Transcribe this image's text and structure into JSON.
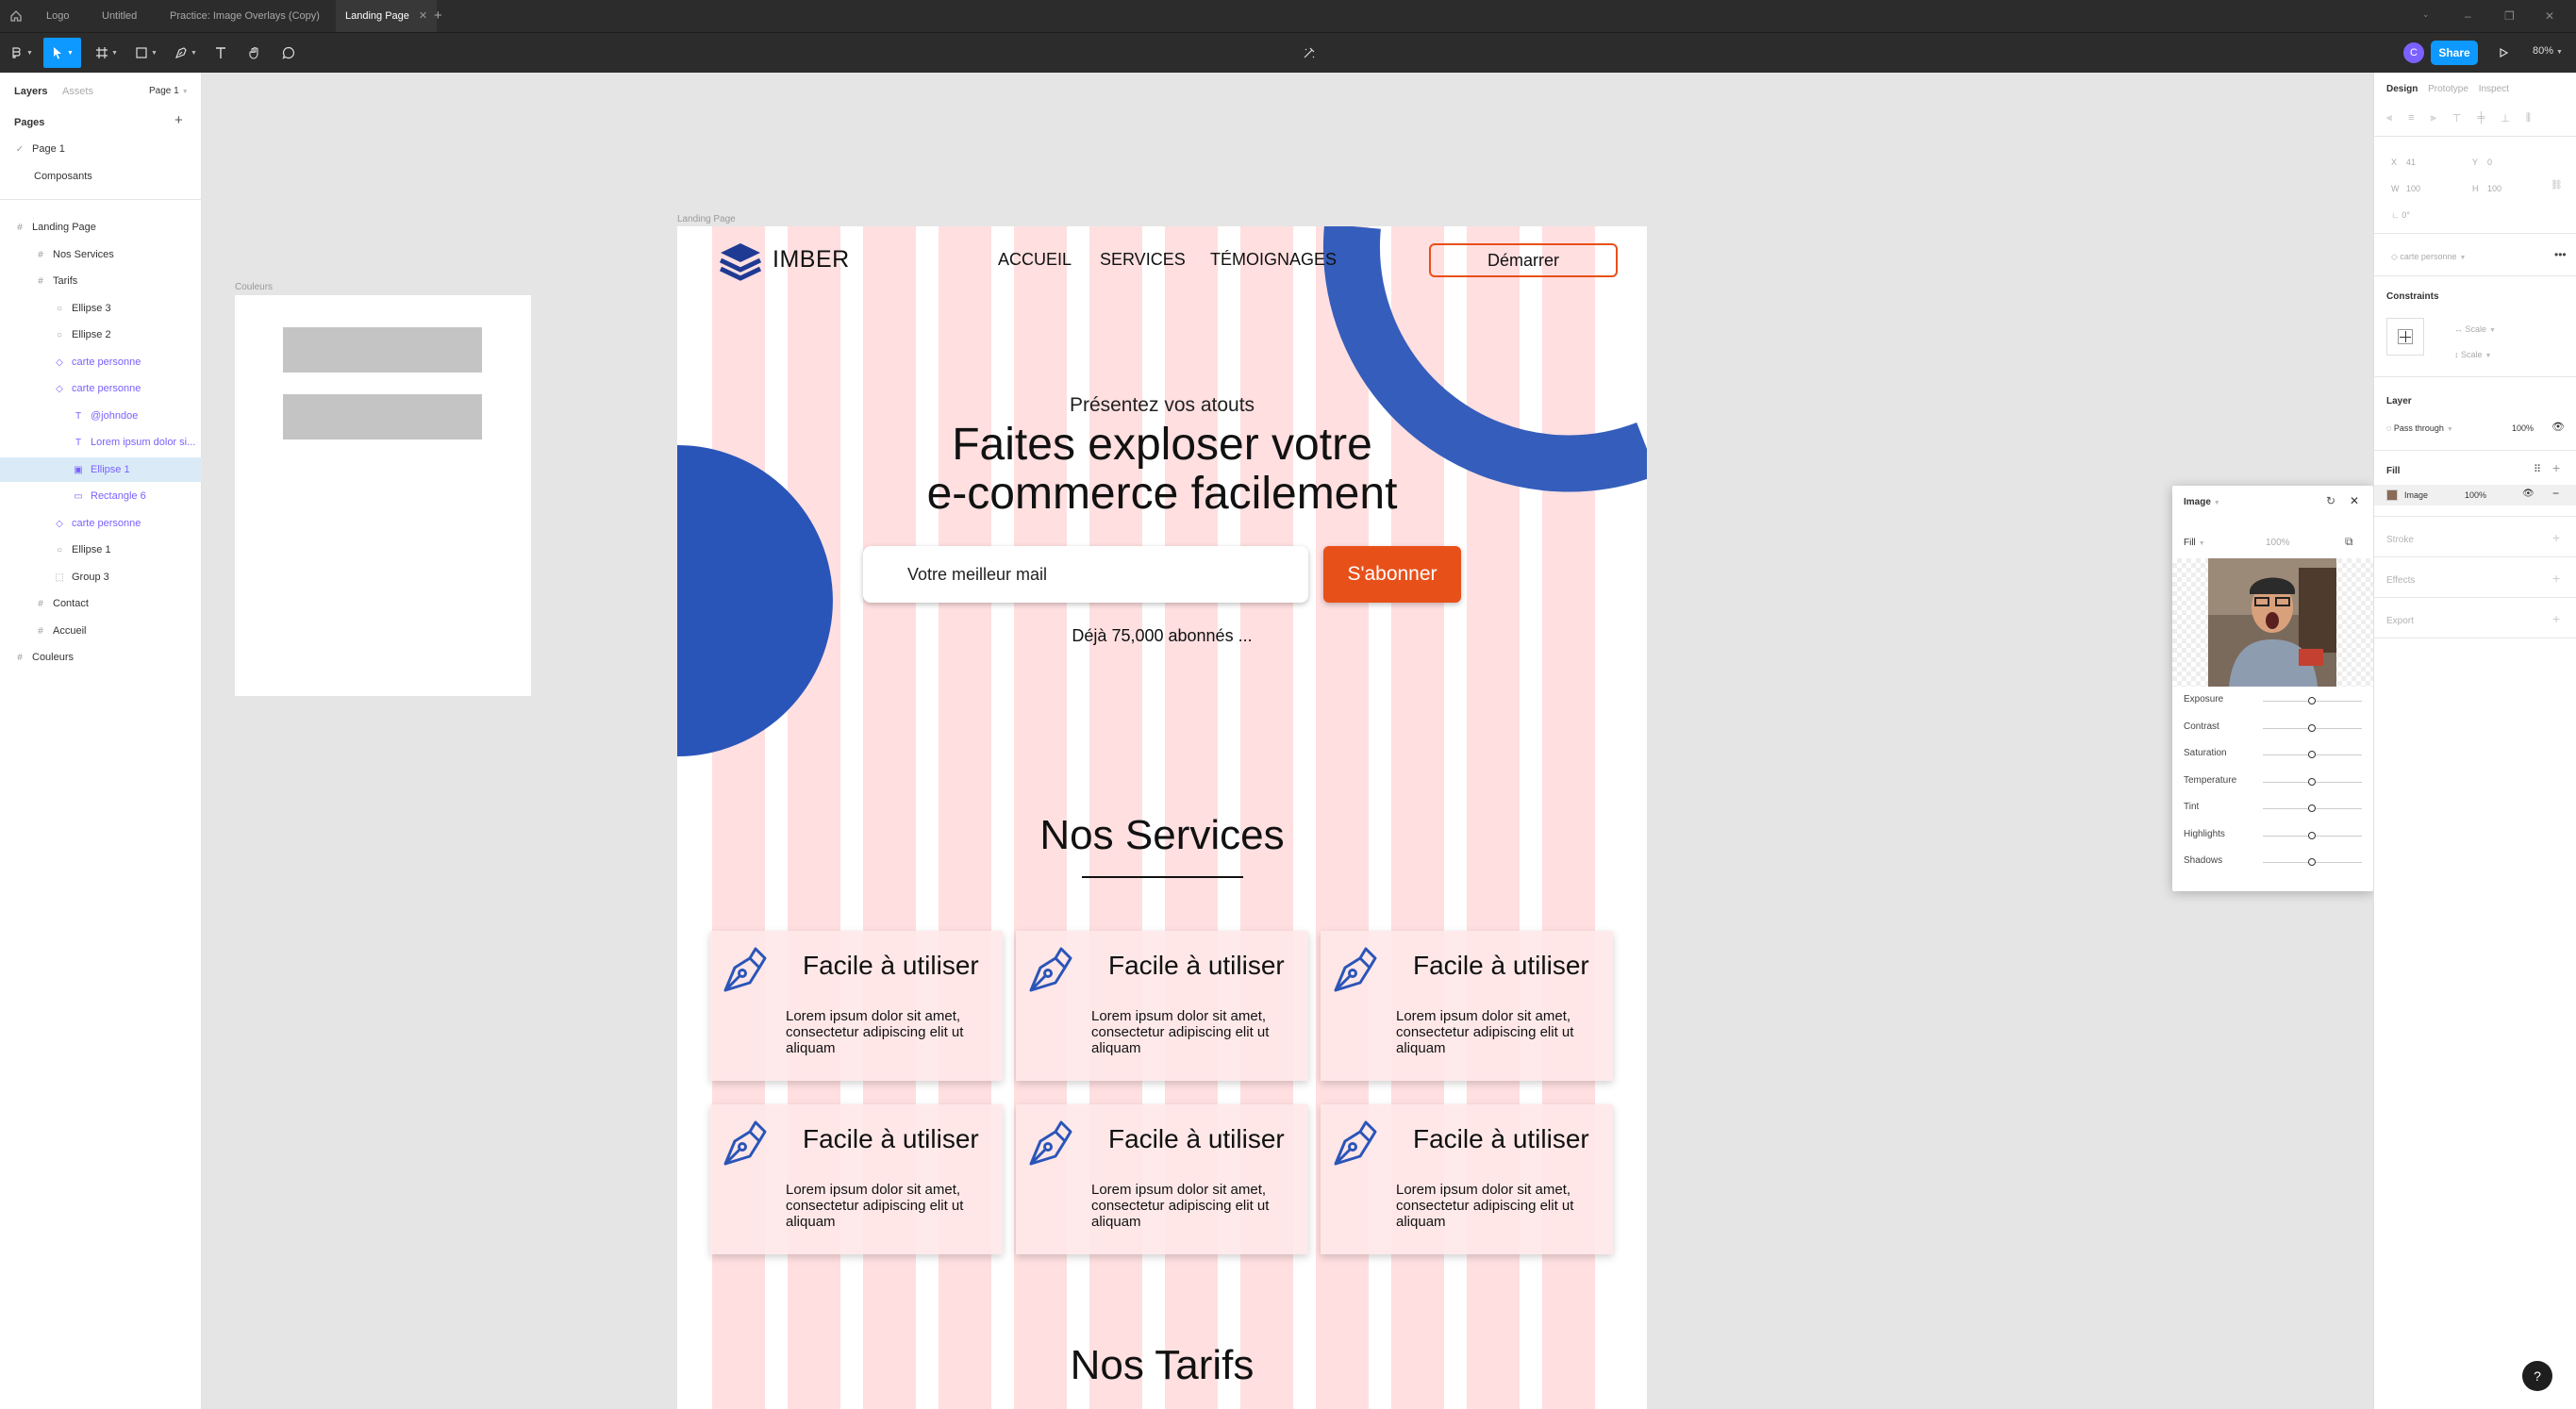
{
  "tabs": [
    {
      "label": "Logo"
    },
    {
      "label": "Untitled"
    },
    {
      "label": "Practice: Image Overlays (Copy)"
    },
    {
      "label": "Landing Page"
    }
  ],
  "toolbar": {
    "user_initial": "C",
    "share_label": "Share",
    "zoom_label": "80%"
  },
  "left_panel": {
    "tabs": [
      "Layers",
      "Assets"
    ],
    "page_selector": "Page 1",
    "pages_title": "Pages",
    "pages": [
      "Page 1",
      "Composants"
    ],
    "layers": [
      "Landing Page",
      "Nos Services",
      "Tarifs",
      "Ellipse 3",
      "Ellipse 2",
      "carte personne",
      "carte personne",
      "@johndoe",
      "Lorem ipsum dolor si...",
      "Ellipse 1",
      "Rectangle 6",
      "carte personne",
      "Ellipse 1",
      "Group 3",
      "Contact",
      "Accueil",
      "Couleurs"
    ]
  },
  "canvas": {
    "couleurs_label": "Couleurs",
    "landing_label": "Landing Page"
  },
  "landing": {
    "logo": "IMBER",
    "nav": [
      "ACCUEIL",
      "SERVICES",
      "TÉMOIGNAGES"
    ],
    "cta": "Démarrer",
    "hero_kicker": "Présentez vos atouts",
    "hero_title_1": "Faites exploser votre",
    "hero_title_2": "e-commerce facilement",
    "email_placeholder": "Votre meilleur mail",
    "subscribe": "S'abonner",
    "subscribers": "Déjà 75,000 abonnés ...",
    "services_title": "Nos Services",
    "card_title": "Facile à utiliser",
    "card_body": "Lorem ipsum dolor sit amet, consectetur adipiscing elit ut aliquam",
    "tarifs_title": "Nos Tarifs"
  },
  "image_popup": {
    "title": "Image",
    "fill_mode": "Fill",
    "opacity": "100%",
    "adjustments": [
      "Exposure",
      "Contrast",
      "Saturation",
      "Temperature",
      "Tint",
      "Highlights",
      "Shadows"
    ]
  },
  "right_panel": {
    "tabs": [
      "Design",
      "Prototype",
      "Inspect"
    ],
    "x_label": "X",
    "x_value": "41",
    "y_label": "Y",
    "y_value": "0",
    "w_label": "W",
    "w_value": "100",
    "h_label": "H",
    "h_value": "100",
    "rotation": "0°",
    "component": "carte personne",
    "constraints_title": "Constraints",
    "constraint_h": "Scale",
    "constraint_v": "Scale",
    "layer_title": "Layer",
    "blend": "Pass through",
    "layer_opacity": "100%",
    "fill_title": "Fill",
    "fill_type": "Image",
    "fill_opacity": "100%",
    "stroke_title": "Stroke",
    "effects_title": "Effects",
    "export_title": "Export"
  },
  "help_label": "?",
  "colors": {
    "accent": "#0d99ff",
    "orange": "#e8501a",
    "blue_shape": "#2a55b8",
    "grid": "#ffdcdd"
  }
}
